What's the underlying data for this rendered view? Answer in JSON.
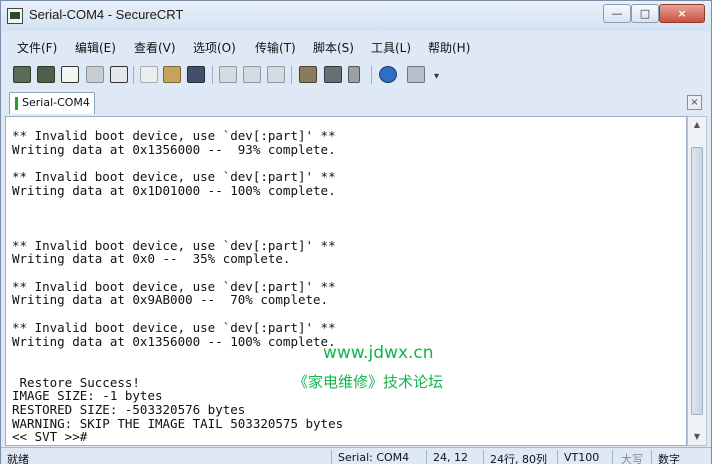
{
  "window": {
    "title": "Serial-COM4 - SecureCRT",
    "controls": {
      "minimize": "—",
      "maximize": "□",
      "close": "×"
    }
  },
  "menu": [
    "文件(F)",
    "编辑(E)",
    "查看(V)",
    "选项(O)",
    "传输(T)",
    "脚本(S)",
    "工具(L)",
    "帮助(H)"
  ],
  "toolbar": {
    "icons": [
      "connect-icon",
      "quick-connect-icon",
      "connect-tab-icon",
      "reconnect-icon",
      "disconnect-icon",
      "copy-icon",
      "paste-icon",
      "find-icon",
      "print-icon",
      "print-selection-icon",
      "print-screen-icon",
      "session-options-icon",
      "global-options-icon",
      "keymap-icon",
      "help-icon",
      "sftp-icon"
    ],
    "more_glyph": "▾"
  },
  "tabs": [
    {
      "label": "Serial-COM4",
      "active": true,
      "marker_color": "#2d9a2d"
    }
  ],
  "tab_close": "×",
  "terminal": {
    "lines": [
      "** Invalid boot device, use `dev[:part]' **",
      "Writing data at 0x1356000 --  93% complete.",
      "",
      "** Invalid boot device, use `dev[:part]' **",
      "Writing data at 0x1D01000 -- 100% complete.",
      "",
      "",
      "",
      "** Invalid boot device, use `dev[:part]' **",
      "Writing data at 0x0 --  35% complete.",
      "",
      "** Invalid boot device, use `dev[:part]' **",
      "Writing data at 0x9AB000 --  70% complete.",
      "",
      "** Invalid boot device, use `dev[:part]' **",
      "Writing data at 0x1356000 -- 100% complete.",
      "",
      "",
      " Restore Success!",
      "IMAGE SIZE: -1 bytes",
      "RESTORED SIZE: -503320576 bytes",
      "WARNING: SKIP THE IMAGE TAIL 503320575 bytes",
      "<< SVT >>#"
    ]
  },
  "scrollbar": {
    "up": "▲",
    "down": "▼"
  },
  "watermark": {
    "url": "www.jdwx.cn",
    "text": "《家电维修》技术论坛",
    "color": "#11b54a"
  },
  "status": {
    "ready": "就绪",
    "connection": "Serial: COM4",
    "cursor": "24, 12",
    "size": "24行, 80列",
    "terminal_type": "VT100",
    "caps": "大写",
    "num": "数字"
  }
}
